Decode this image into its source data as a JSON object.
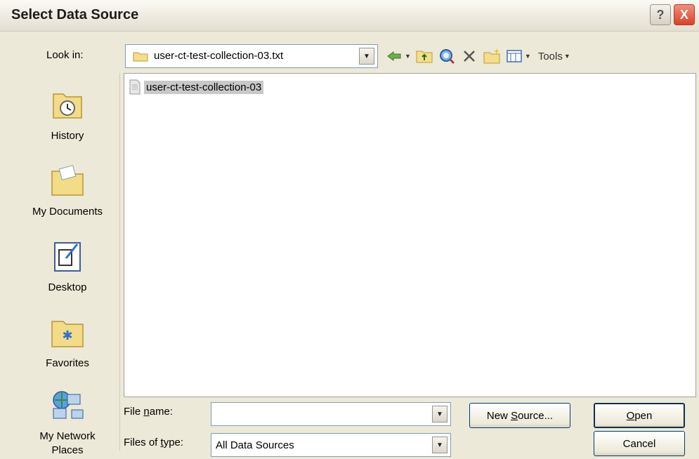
{
  "window": {
    "title": "Select Data Source"
  },
  "titlebar": {
    "help_symbol": "?",
    "close_symbol": "X"
  },
  "lookin": {
    "label": "Look in:",
    "value": "user-ct-test-collection-03.txt"
  },
  "toolbar": {
    "tools_label": "Tools"
  },
  "places": [
    {
      "label": "History",
      "icon": "history-icon"
    },
    {
      "label": "My Documents",
      "icon": "my-documents-icon"
    },
    {
      "label": "Desktop",
      "icon": "desktop-icon"
    },
    {
      "label": "Favorites",
      "icon": "favorites-icon"
    },
    {
      "label": "My Network Places",
      "icon": "network-places-icon"
    }
  ],
  "files": [
    {
      "name": "user-ct-test-collection-03",
      "selected": true
    }
  ],
  "filename": {
    "label": "File name:",
    "value": ""
  },
  "filetype": {
    "label": "Files of type:",
    "value": "All Data Sources"
  },
  "buttons": {
    "new_source": "New Source...",
    "open": "Open",
    "cancel": "Cancel"
  },
  "colors": {
    "background": "#ece9d8",
    "selection": "#c8c8c8",
    "close_button": "#d9422b"
  }
}
